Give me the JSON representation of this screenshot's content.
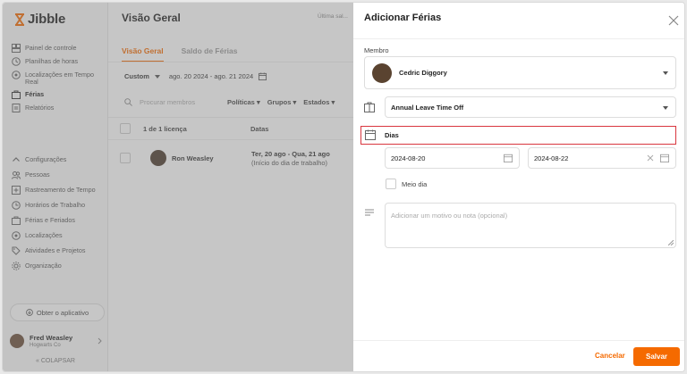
{
  "sidebar": {
    "logo": "Jibble",
    "items": [
      {
        "label": "Painel de controle",
        "icon": "dashboard-icon"
      },
      {
        "label": "Planilhas de horas",
        "icon": "clock-icon"
      },
      {
        "label": "Localizações em Tempo Real",
        "icon": "location-icon"
      },
      {
        "label": "Férias",
        "icon": "briefcase-icon",
        "active": true
      },
      {
        "label": "Relatórios",
        "icon": "report-icon"
      }
    ],
    "settings_items": [
      {
        "label": "Configurações",
        "icon": "chevron-up-icon"
      },
      {
        "label": "Pessoas",
        "icon": "people-icon"
      },
      {
        "label": "Rastreamento de Tempo",
        "icon": "tracking-icon"
      },
      {
        "label": "Horários de Trabalho",
        "icon": "schedule-icon"
      },
      {
        "label": "Férias e Feriados",
        "icon": "briefcase-icon"
      },
      {
        "label": "Localizações",
        "icon": "location-icon"
      },
      {
        "label": "Atividades e Projetos",
        "icon": "tag-icon"
      },
      {
        "label": "Organização",
        "icon": "gear-icon"
      }
    ],
    "get_app": "Obter o aplicativo",
    "user": {
      "name": "Fred Weasley",
      "org": "Hogwarts Co"
    },
    "collapse": "COLAPSAR"
  },
  "main": {
    "title": "Visão Geral",
    "last_update": "Última sal...",
    "tabs": [
      {
        "label": "Visão Geral",
        "active": true
      },
      {
        "label": "Saldo de Férias",
        "active": false
      }
    ],
    "filter": {
      "period": "Custom",
      "range": "ago. 20 2024 - ago. 21 2024"
    },
    "search_placeholder": "Procurar membros",
    "dropdowns": [
      "Políticas",
      "Grupos",
      "Estados"
    ],
    "table": {
      "headers": [
        "1 de 1 licença",
        "Datas"
      ],
      "rows": [
        {
          "name": "Ron Weasley",
          "dates": "Ter, 20 ago - Qua, 21 ago",
          "sub": "(Início do dia de trabalho)"
        }
      ]
    }
  },
  "panel": {
    "title": "Adicionar Férias",
    "member_label": "Membro",
    "member": "Cedric Diggory",
    "leave_type": "Annual Leave Time Off",
    "days_label": "Dias",
    "start_date": "2024-08-20",
    "end_date": "2024-08-22",
    "half_day": "Meio dia",
    "note_placeholder": "Adicionar um motivo ou nota (opcional)",
    "cancel": "Cancelar",
    "save": "Salvar"
  },
  "colors": {
    "accent": "#f56a00",
    "highlight": "#d9363e"
  }
}
